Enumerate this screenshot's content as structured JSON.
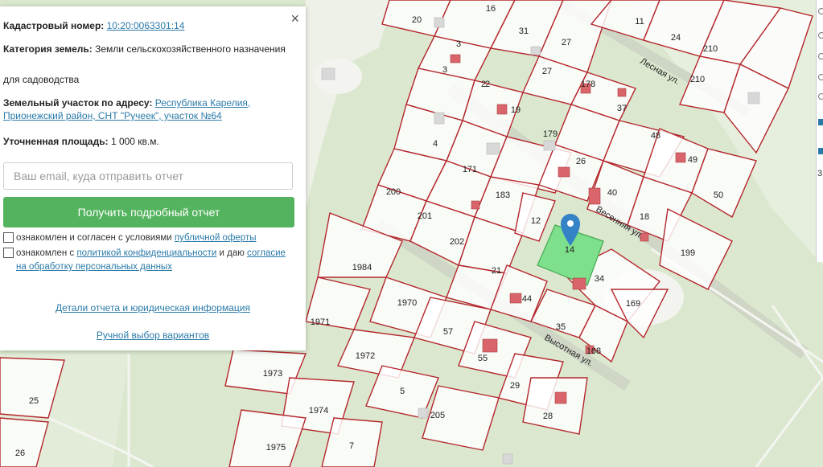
{
  "panel": {
    "close_icon": "×",
    "cadastral_label": "Кадастровый номер:",
    "cadastral_value": "10:20:0063301:14",
    "category_label": "Категория земель:",
    "category_value": "Земли сельскохозяйственного назначения",
    "category_use": "для садоводства",
    "address_label": "Земельный участок по адресу:",
    "address_value": "Республика Карелия, Прионежский район, СНТ \"Ручеек\", участок №64",
    "area_label": "Уточненная площадь:",
    "area_value": "1 000 кв.м.",
    "email_placeholder": "Ваш email, куда отправить отчет",
    "submit_label": "Получить подробный отчет",
    "agree1_text": "ознакомлен и согласен с условиями",
    "agree1_link": "публичной оферты",
    "agree2_text_a": "ознакомлен с",
    "agree2_link": "политикой конфиденциальности",
    "agree2_text_b": "и даю",
    "agree2_link2": "согласие на обработку персональных данных",
    "details_link": "Детали отчета и юридическая информация",
    "manual_link": "Ручной выбор вариантов"
  },
  "map": {
    "selected_plot": "14",
    "highlight_color": "#7ee08c",
    "boundary_color": "#b4262c",
    "marker_color": "#3483c6",
    "building_color": "#d9656a",
    "street_labels": [
      "Лесная ул.",
      "Весенняя ул.",
      "Высотная ул."
    ],
    "plot_numbers": [
      "20",
      "16",
      "3",
      "31",
      "27",
      "11",
      "24",
      "2",
      "3",
      "27",
      "178",
      "210",
      "210",
      "19",
      "2",
      "37",
      "179",
      "48",
      "4",
      "171",
      "26",
      "49",
      "183",
      "40",
      "200",
      "201",
      "12",
      "18",
      "50",
      "202",
      "14",
      "21",
      "34",
      "199",
      "1984",
      "44",
      "169",
      "1970",
      "35",
      "168",
      "1971",
      "57",
      "55",
      "1972",
      "1973",
      "29",
      "5",
      "25",
      "205",
      "28",
      "1974",
      "1975",
      "7",
      "26"
    ]
  },
  "right_edge": {
    "partial_char": "3"
  }
}
